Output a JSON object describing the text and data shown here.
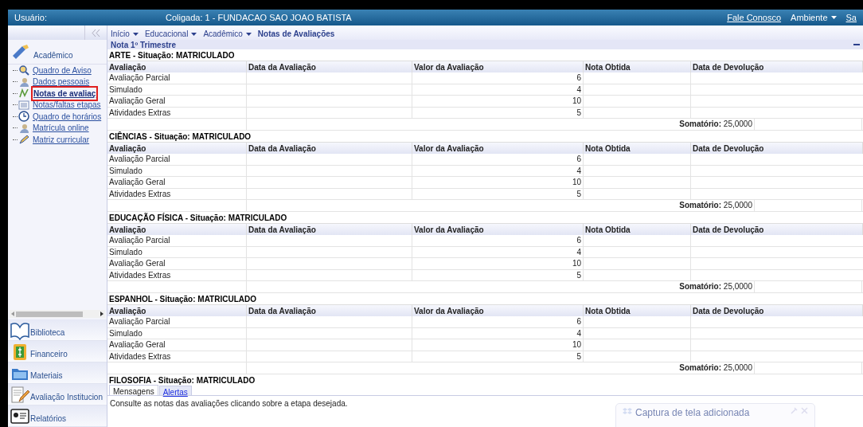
{
  "top_bar": {
    "user_label": "Usuário:",
    "coligada": "Coligada: 1 - FUNDACAO SAO JOAO BATISTA",
    "links": [
      {
        "label": "Fale Conosco",
        "kind": "link"
      },
      {
        "label": "Ambiente",
        "kind": "menu"
      },
      {
        "label": "Sa",
        "kind": "link"
      }
    ]
  },
  "sidebar": {
    "section_title": "Acadêmico",
    "items": [
      {
        "label": "Quadro de Aviso",
        "kind": "search",
        "selected": false
      },
      {
        "label": "Dados pessoais",
        "kind": "person",
        "selected": false
      },
      {
        "label": "Notas de avaliaç",
        "kind": "grades",
        "selected": true
      },
      {
        "label": "Notas/faltas etapas",
        "kind": "list",
        "selected": false
      },
      {
        "label": "Quadro de horários",
        "kind": "clock",
        "selected": false
      },
      {
        "label": "Matrícula online",
        "kind": "person",
        "selected": false
      },
      {
        "label": "Matriz curricular",
        "kind": "pencil",
        "selected": false
      }
    ],
    "modules": [
      {
        "label": "Biblioteca",
        "kind": "book"
      },
      {
        "label": "Financeiro",
        "kind": "money"
      },
      {
        "label": "Materiais",
        "kind": "folder"
      },
      {
        "label": "Avaliação Institucion",
        "kind": "form"
      },
      {
        "label": "Relatórios",
        "kind": "report"
      }
    ]
  },
  "breadcrumb": [
    {
      "label": "Início",
      "kind": "menu"
    },
    {
      "label": "Educacional",
      "kind": "menu"
    },
    {
      "label": "Acadêmico",
      "kind": "menu"
    },
    {
      "label": "Notas de Avaliações",
      "kind": "current"
    }
  ],
  "panel_title": "Nota 1º Trimestre",
  "subjects": [
    {
      "title": "ARTE - Situação: MATRICULADO",
      "columns": [
        "Avaliação",
        "Data da Avaliação",
        "Valor da Avaliação",
        "Nota Obtida",
        "Data de Devolução"
      ],
      "rows": [
        {
          "avaliacao": "Avaliação Parcial",
          "valor": "6"
        },
        {
          "avaliacao": "Simulado",
          "valor": "4"
        },
        {
          "avaliacao": "Avaliação Geral",
          "valor": "10"
        },
        {
          "avaliacao": "Atividades Extras",
          "valor": "5"
        }
      ],
      "total_label": "Somatório:",
      "total_value": "25,0000"
    },
    {
      "title": "CIÊNCIAS - Situação: MATRICULADO",
      "columns": [
        "Avaliação",
        "Data da Avaliação",
        "Valor da Avaliação",
        "Nota Obtida",
        "Data de Devolução"
      ],
      "rows": [
        {
          "avaliacao": "Avaliação Parcial",
          "valor": "6"
        },
        {
          "avaliacao": "Simulado",
          "valor": "4"
        },
        {
          "avaliacao": "Avaliação Geral",
          "valor": "10"
        },
        {
          "avaliacao": "Atividades Extras",
          "valor": "5"
        }
      ],
      "total_label": "Somatório:",
      "total_value": "25,0000"
    },
    {
      "title": "EDUCAÇÃO FÍSICA - Situação: MATRICULADO",
      "columns": [
        "Avaliação",
        "Data da Avaliação",
        "Valor da Avaliação",
        "Nota Obtida",
        "Data de Devolução"
      ],
      "rows": [
        {
          "avaliacao": "Avaliação Parcial",
          "valor": "6"
        },
        {
          "avaliacao": "Simulado",
          "valor": "4"
        },
        {
          "avaliacao": "Avaliação Geral",
          "valor": "10"
        },
        {
          "avaliacao": "Atividades Extras",
          "valor": "5"
        }
      ],
      "total_label": "Somatório:",
      "total_value": "25,0000"
    },
    {
      "title": "ESPANHOL - Situação: MATRICULADO",
      "columns": [
        "Avaliação",
        "Data da Avaliação",
        "Valor da Avaliação",
        "Nota Obtida",
        "Data de Devolução"
      ],
      "rows": [
        {
          "avaliacao": "Avaliação Parcial",
          "valor": "6"
        },
        {
          "avaliacao": "Simulado",
          "valor": "4"
        },
        {
          "avaliacao": "Avaliação Geral",
          "valor": "10"
        },
        {
          "avaliacao": "Atividades Extras",
          "valor": "5"
        }
      ],
      "total_label": "Somatório:",
      "total_value": "25,0000"
    },
    {
      "title": "FILOSOFIA - Situação: MATRICULADO"
    }
  ],
  "bottom_tabs": [
    {
      "label": "Mensagens",
      "selected": true
    },
    {
      "label": "Alertas",
      "selected": false
    }
  ],
  "message": "Consulte as notas das avaliações clicando sobre a etapa desejada.",
  "toast": {
    "title": "Captura de tela adicionada"
  }
}
